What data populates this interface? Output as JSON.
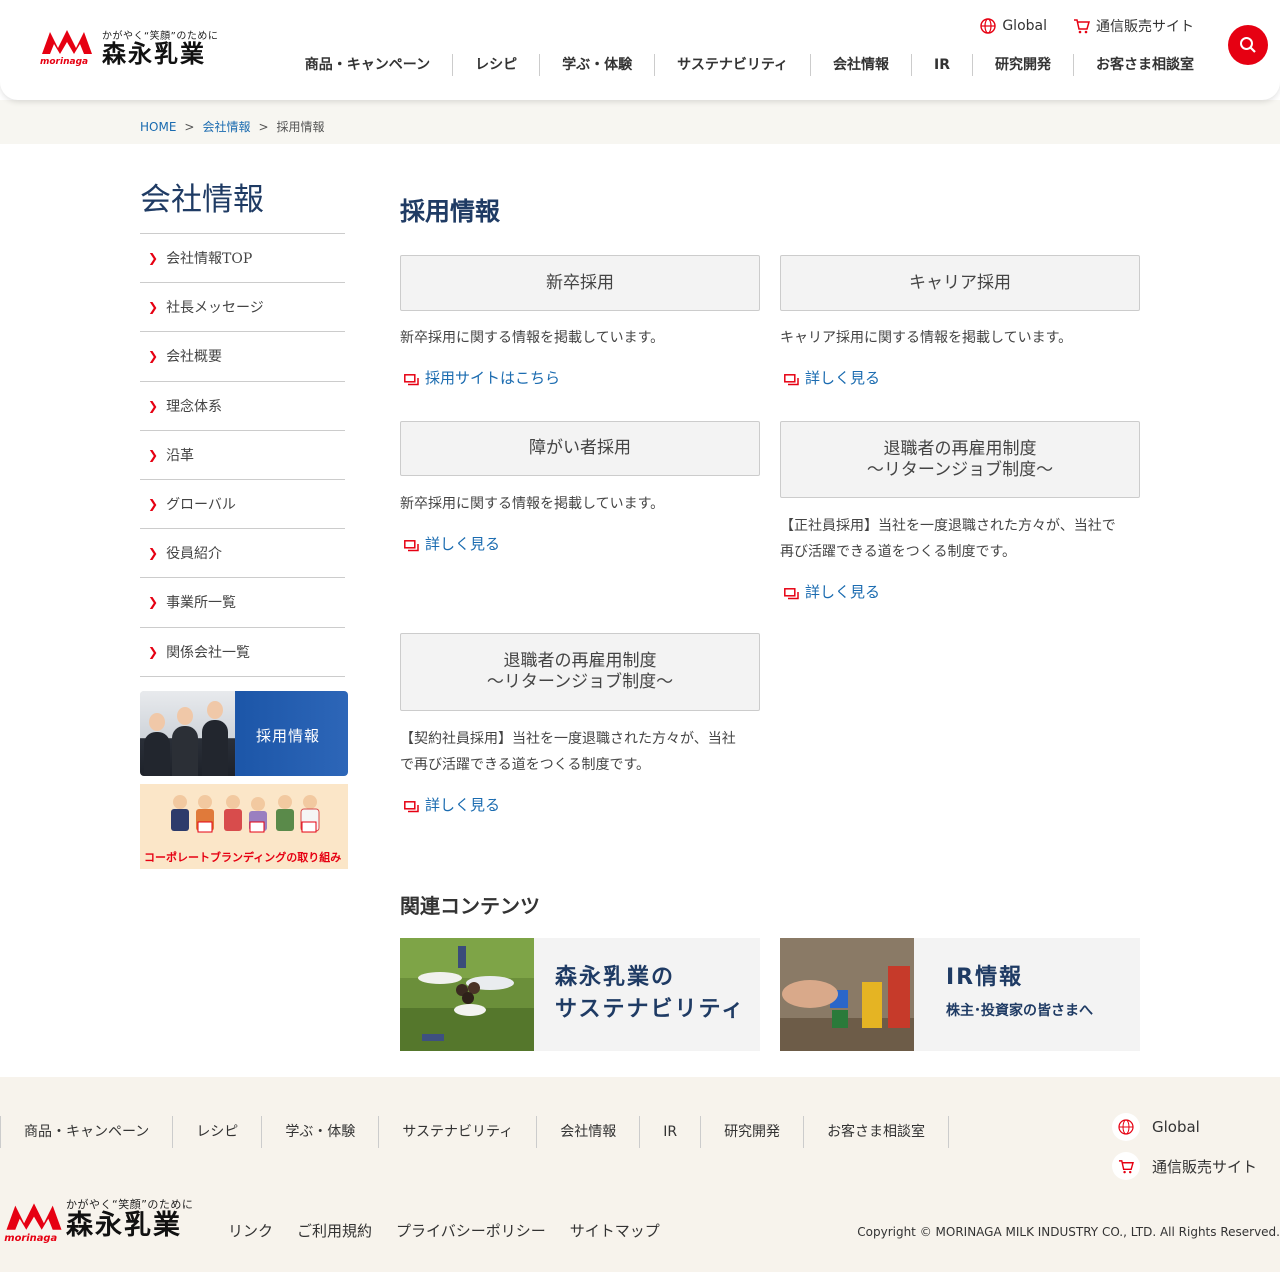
{
  "header": {
    "logo_tagline": "かがやく“笑顔”のために",
    "logo_name": "森永乳業",
    "logo_mark_text": "morinaga",
    "util_global": "Global",
    "util_shop": "通信販売サイト",
    "nav": [
      "商品・キャンペーン",
      "レシピ",
      "学ぶ・体験",
      "サステナビリティ",
      "会社情報",
      "IR",
      "研究開発",
      "お客さま相談室"
    ]
  },
  "breadcrumb": {
    "home": "HOME",
    "sep": ">",
    "parent": "会社情報",
    "current": "採用情報"
  },
  "sidebar": {
    "title": "会社情報",
    "items": [
      "会社情報TOP",
      "社長メッセージ",
      "会社概要",
      "理念体系",
      "沿革",
      "グローバル",
      "役員紹介",
      "事業所一覧",
      "関係会社一覧"
    ],
    "banner_recruit": "採用情報",
    "banner_branding": "コーポレートブランディングの取り組み"
  },
  "main": {
    "title": "採用情報",
    "cards": [
      {
        "title": "新卒採用",
        "desc": "新卒採用に関する情報を掲載しています。",
        "link": "採用サイトはこちら"
      },
      {
        "title": "キャリア採用",
        "desc": "キャリア採用に関する情報を掲載しています。",
        "link": "詳しく見る"
      },
      {
        "title": "障がい者採用",
        "desc": "新卒採用に関する情報を掲載しています。",
        "link": "詳しく見る"
      },
      {
        "title_line1": "退職者の再雇用制度",
        "title_line2": "～リターンジョブ制度～",
        "desc_line1": "【正社員採用】当社を一度退職された方々が、当社で",
        "desc_line2": "再び活躍できる道をつくる制度です。",
        "link": "詳しく見る"
      },
      {
        "title_line1": "退職者の再雇用制度",
        "title_line2": "～リターンジョブ制度～",
        "desc_line1": "【契約社員採用】当社を一度退職された方々が、当社",
        "desc_line2": "で再び活躍できる道をつくる制度です。",
        "link": "詳しく見る"
      }
    ],
    "related_title": "関連コンテンツ",
    "related": [
      {
        "line1": "森永乳業の",
        "line2": "サステナビリティ"
      },
      {
        "line1": "IR情報",
        "line2": "株主･投資家の皆さまへ"
      }
    ]
  },
  "footer": {
    "nav": [
      "商品・キャンペーン",
      "レシピ",
      "学ぶ・体験",
      "サステナビリティ",
      "会社情報",
      "IR",
      "研究開発",
      "お客さま相談室"
    ],
    "global": "Global",
    "shop": "通信販売サイト",
    "links": [
      "リンク",
      "ご利用規約",
      "プライバシーポリシー",
      "サイトマップ"
    ],
    "copyright": "Copyright © MORINAGA MILK INDUSTRY CO., LTD. All Rights Reserved."
  },
  "colors": {
    "brand_red": "#e60012",
    "navy": "#1f3b64",
    "link_blue": "#1a6bb0"
  }
}
